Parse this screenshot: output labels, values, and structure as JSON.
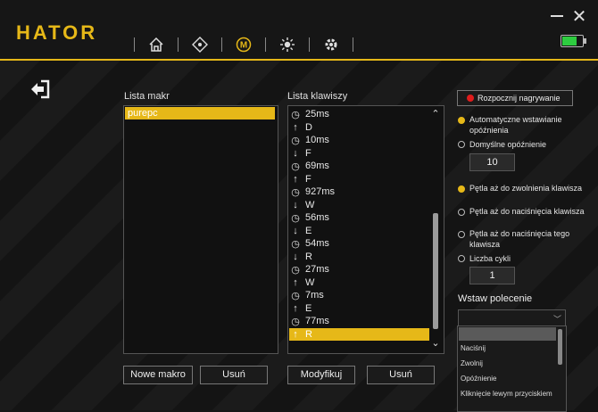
{
  "app": {
    "logo": "HATOR"
  },
  "nav": [
    "home-icon",
    "dpad-icon",
    "macro-icon",
    "lighting-icon",
    "gear-icon"
  ],
  "colors": {
    "accent": "#e6b818",
    "record": "#e01c1c",
    "battery": "#2ecc40"
  },
  "macros": {
    "title": "Lista makr",
    "items": [
      "purepc"
    ],
    "new_button": "Nowe makro",
    "delete_button": "Usuń"
  },
  "keys": {
    "title": "Lista klawiszy",
    "rows": [
      {
        "icon": "clock-icon",
        "text": "25ms"
      },
      {
        "icon": "arrow-up-icon",
        "text": "D"
      },
      {
        "icon": "clock-icon",
        "text": "10ms"
      },
      {
        "icon": "arrow-down-icon",
        "text": "F"
      },
      {
        "icon": "clock-icon",
        "text": "69ms"
      },
      {
        "icon": "arrow-up-icon",
        "text": "F"
      },
      {
        "icon": "clock-icon",
        "text": "927ms"
      },
      {
        "icon": "arrow-down-icon",
        "text": "W"
      },
      {
        "icon": "clock-icon",
        "text": "56ms"
      },
      {
        "icon": "arrow-down-icon",
        "text": "E"
      },
      {
        "icon": "clock-icon",
        "text": "54ms"
      },
      {
        "icon": "arrow-down-icon",
        "text": "R"
      },
      {
        "icon": "clock-icon",
        "text": "27ms"
      },
      {
        "icon": "arrow-up-icon",
        "text": "W"
      },
      {
        "icon": "clock-icon",
        "text": "7ms"
      },
      {
        "icon": "arrow-up-icon",
        "text": "E"
      },
      {
        "icon": "clock-icon",
        "text": "77ms"
      },
      {
        "icon": "arrow-up-icon",
        "text": "R",
        "selected": true
      }
    ],
    "modify_button": "Modyfikuj",
    "delete_button": "Usuń"
  },
  "options": {
    "record_button": "Rozpocznij nagrywanie",
    "auto_delay": "Automatyczne wstawianie opóźnienia",
    "default_delay": "Domyślne opóźnienie",
    "default_delay_value": "10",
    "loop_release": "Pętla aż do zwolnienia klawisza",
    "loop_press": "Pętla aż do naciśnięcia klawisza",
    "loop_press_same": "Pętla aż do naciśnięcia tego klawisza",
    "cycles": "Liczba cykli",
    "cycles_value": "1"
  },
  "command": {
    "label": "Wstaw polecenie",
    "items": [
      "Naciśnij",
      "Zwolnij",
      "Opóźnienie",
      "Kliknięcie lewym przyciskiem"
    ]
  }
}
